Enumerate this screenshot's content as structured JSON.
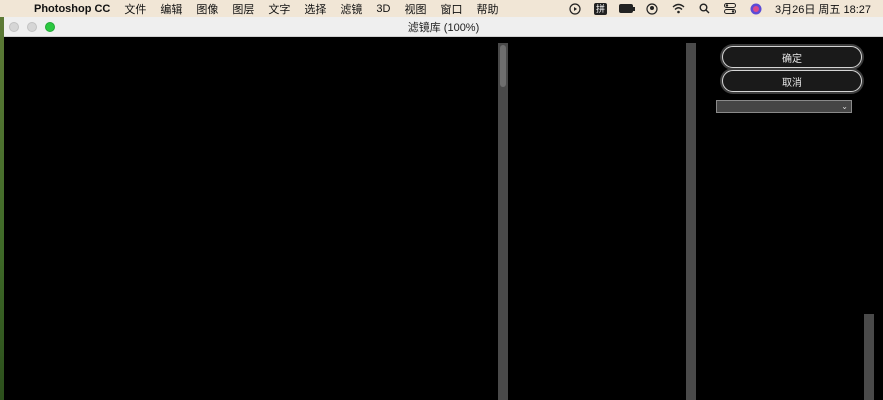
{
  "menubar": {
    "apple_icon": "apple-logo-icon",
    "app_name": "Photoshop CC",
    "items": [
      "文件",
      "编辑",
      "图像",
      "图层",
      "文字",
      "选择",
      "滤镜",
      "3D",
      "视图",
      "窗口",
      "帮助"
    ],
    "status_icons": [
      "screen-record-icon",
      "input-method-icon",
      "battery-icon",
      "user-icon",
      "wifi-icon",
      "search-icon",
      "control-center-icon",
      "siri-icon"
    ],
    "ime_label": "拼",
    "datetime": "3月26日 周五 18:27"
  },
  "window": {
    "title": "滤镜库 (100%)"
  },
  "settings": {
    "ok_label": "确定",
    "cancel_label": "取消",
    "filter_select_value": ""
  },
  "colors": {
    "menubar_bg": "#f1e6d6",
    "dialog_bg": "#000000",
    "maximize_green": "#2bc840"
  }
}
